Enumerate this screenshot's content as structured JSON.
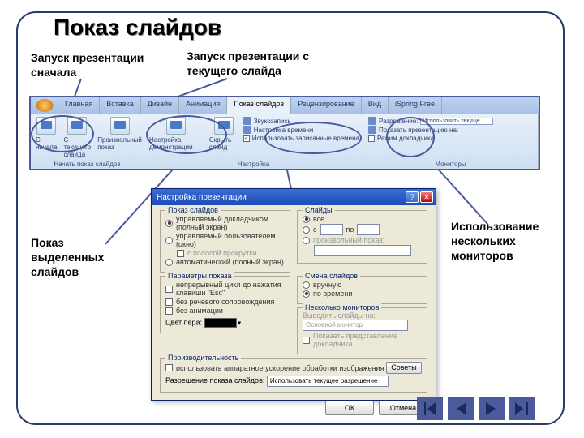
{
  "title": "Показ слайдов",
  "callouts": {
    "c1": "Запуск презентации сначала",
    "c2": "Запуск презентации с текущего слайда",
    "c3": "Показ выделенных слайдов",
    "c4": "Использование нескольких мониторов"
  },
  "ribbon": {
    "tabs": [
      "Главная",
      "Вставка",
      "Дизайн",
      "Анимация",
      "Показ слайдов",
      "Рецензирование",
      "Вид",
      "iSpring Free"
    ],
    "active_tab": 4,
    "group1": {
      "label": "Начать показ слайдов",
      "btns": [
        "С начала",
        "С текущего слайда",
        "Произвольный показ"
      ]
    },
    "group2": {
      "label": "Настройка",
      "btns": [
        "Настройка демонстрации",
        "Скрыть слайд"
      ],
      "items": [
        "Звукозапись",
        "Настройка времени"
      ],
      "chk": "Использовать записанные времена"
    },
    "group3": {
      "label": "Мониторы",
      "items_label": "Разрешение:",
      "dropdown": "Использовать текуще...",
      "chk1": "Показать презентацию на:",
      "chk2": "Режим докладчика"
    }
  },
  "dialog": {
    "title": "Настройка презентации",
    "fs1": {
      "legend": "Показ слайдов",
      "r1": "управляемый докладчиком (полный экран)",
      "r2": "управляемый пользователем (окно)",
      "chk_sub": "с полосой прокрутки",
      "r3": "автоматический (полный экран)"
    },
    "fs2": {
      "legend": "Слайды",
      "r1": "все",
      "r2_a": "с",
      "r2_b": "по",
      "r3": "произвольный показ:"
    },
    "fs3": {
      "legend": "Параметры показа",
      "c1": "непрерывный цикл до нажатия клавиши \"Esc\"",
      "c2": "без речевого сопровождения",
      "c3": "без анимации",
      "pen": "Цвет пера:"
    },
    "fs4": {
      "legend": "Смена слайдов",
      "r1": "вручную",
      "r2": "по времени"
    },
    "fs5": {
      "legend": "Несколько мониторов",
      "lbl": "Выводить слайды на:",
      "val": "Основной монитор",
      "chk": "Показать представление докладчика"
    },
    "fs6": {
      "legend": "Производительность",
      "chk": "использовать аппаратное ускорение обработки изображения",
      "hint": "Советы",
      "res_lbl": "Разрешение показа слайдов:",
      "res_val": "Использовать текущее разрешение"
    },
    "ok": "ОК",
    "cancel": "Отмена"
  }
}
